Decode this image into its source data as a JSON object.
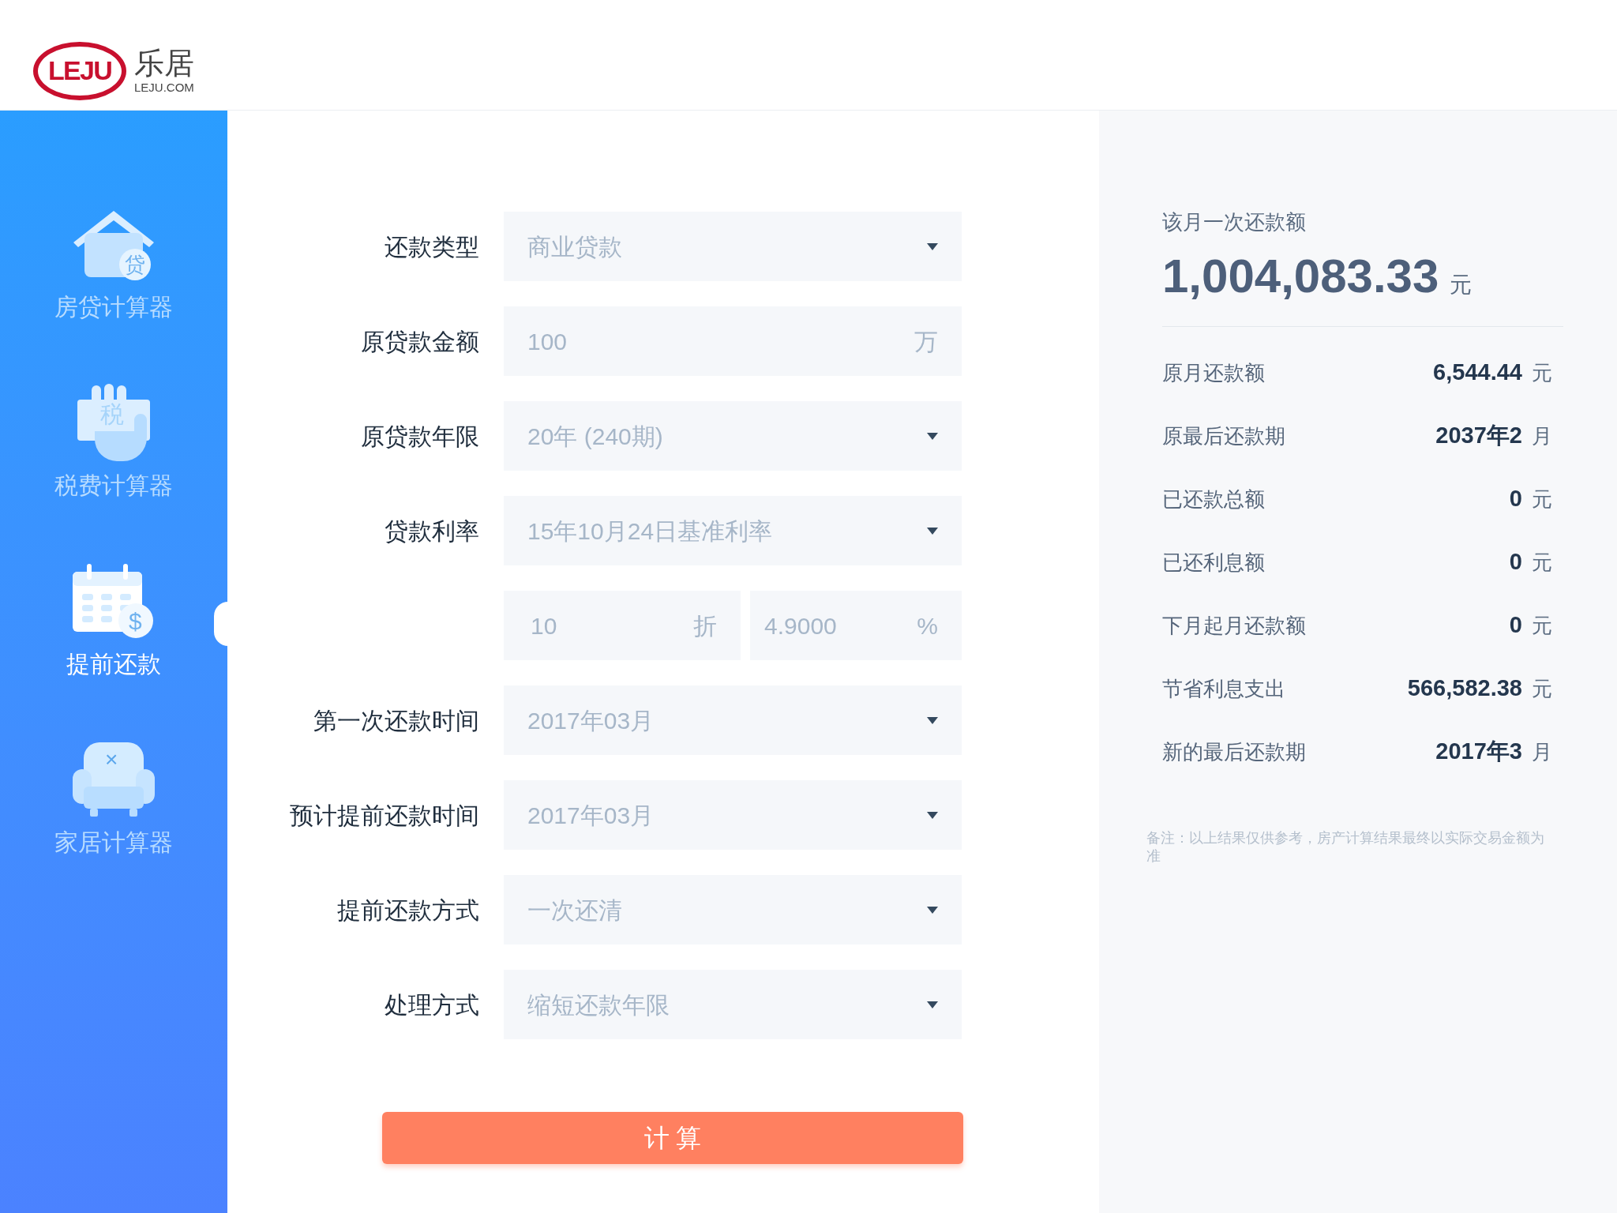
{
  "logo": {
    "mark": "LEJU",
    "name": "乐居",
    "domain": "LEJU.COM"
  },
  "sidebar": {
    "items": [
      {
        "kind": "house",
        "glyph": "贷",
        "label": "房贷计算器",
        "selected": false
      },
      {
        "kind": "hand",
        "glyph": "税",
        "label": "税费计算器",
        "selected": false
      },
      {
        "kind": "calendar",
        "glyph": "$",
        "label": "提前还款",
        "selected": true
      },
      {
        "kind": "sofa",
        "glyph": "×",
        "label": "家居计算器",
        "selected": false
      }
    ]
  },
  "form": {
    "rows": [
      {
        "kind": "select",
        "label": "还款类型",
        "value": "商业贷款"
      },
      {
        "kind": "input",
        "label": "原贷款金额",
        "value": "100",
        "unit": "万"
      },
      {
        "kind": "select",
        "label": "原贷款年限",
        "value": "20年 (240期)"
      },
      {
        "kind": "select",
        "label": "贷款利率",
        "value": "15年10月24日基准利率"
      },
      {
        "kind": "split",
        "parts": [
          {
            "value": "10",
            "unit": "折"
          },
          {
            "value": "4.9000",
            "unit": "%"
          }
        ]
      },
      {
        "kind": "select",
        "label": "第一次还款时间",
        "value": "2017年03月"
      },
      {
        "kind": "select",
        "label": "预计提前还款时间",
        "value": "2017年03月"
      },
      {
        "kind": "select",
        "label": "提前还款方式",
        "value": "一次还清"
      },
      {
        "kind": "select",
        "label": "处理方式",
        "value": "缩短还款年限"
      }
    ],
    "submit": "计 算"
  },
  "result": {
    "title": "该月一次还款额",
    "amount": "1,004,083.33",
    "amount_unit": "元",
    "rows": [
      {
        "label": "原月还款额",
        "value": "6,544.44",
        "unit": "元"
      },
      {
        "label": "原最后还款期",
        "value": "2037年2",
        "unit": "月"
      },
      {
        "label": "已还款总额",
        "value": "0",
        "unit": "元"
      },
      {
        "label": "已还利息额",
        "value": "0",
        "unit": "元"
      },
      {
        "label": "下月起月还款额",
        "value": "0",
        "unit": "元"
      },
      {
        "label": "节省利息支出",
        "value": "566,582.38",
        "unit": "元"
      },
      {
        "label": "新的最后还款期",
        "value": "2017年3",
        "unit": "月"
      }
    ],
    "note": "备注：以上结果仅供参考，房产计算结果最终以实际交易金额为准"
  }
}
